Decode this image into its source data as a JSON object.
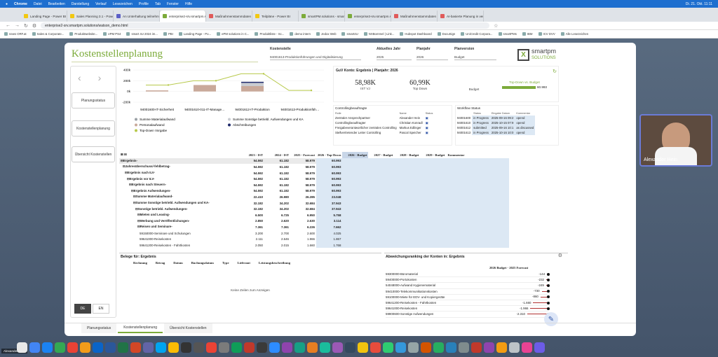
{
  "macbar": {
    "items": [
      "Chrome",
      "Datei",
      "Bearbeiten",
      "Darstellung",
      "Verlauf",
      "Lesezeichen",
      "Profile",
      "Tab",
      "Fenster",
      "Hilfe"
    ],
    "clock": "Di. 21. Okt. 11:11"
  },
  "tabs": [
    {
      "label": "Landing Page - Power BI",
      "color": "#f2c811"
    },
    {
      "label": "Sales Planning 3.1 - Power BI",
      "color": "#f2c811"
    },
    {
      "label": "An Unterhaltung teilnehmen",
      "color": "#5b5fc7"
    },
    {
      "label": "enterprise2-srv.smartpm.so",
      "color": "#7cab3a",
      "active": true
    },
    {
      "label": "Maßnahmenstammdaten P/",
      "color": "#e05a5a"
    },
    {
      "label": "Teilpläne - Power BI",
      "color": "#f2c811"
    },
    {
      "label": "smartPM.solutions - smart C",
      "color": "#7cab3a"
    },
    {
      "label": "enterprise3-srv.smartpm.so",
      "color": "#7cab3a"
    },
    {
      "label": "Maßnahmenstammdaten P/",
      "color": "#e05a5a"
    },
    {
      "label": "AI-basierte Planung in verti",
      "color": "#e05a5a"
    }
  ],
  "address": {
    "url": "enterprise2-srv.smartpm.solutions/watson_demo.html"
  },
  "bookmarks": [
    "news ORF.at",
    "Sales & Corporate...",
    "Produktwebsite...",
    "ePM PS4",
    "smart 4U 2024 im...",
    "PBI",
    "Landing Page - Po...",
    "ePM solutions in C...",
    "Produktliste - Sc...",
    "demo intern",
    "Jedox Web",
    "smart4U",
    "NXBommel | Link...",
    "Hubspot Dashboard",
    "DocuSign",
    "UniCredit Corpora...",
    "smartPMs",
    "IBM",
    "ICV DVV",
    "Alle Lesezeichen"
  ],
  "page": {
    "title": "Kostenstellenplanung",
    "filters": [
      {
        "label": "Kostenstelle",
        "value": "94001613-Produktionführungen und Digitalisierung"
      },
      {
        "label": "Aktuelles Jahr",
        "value": "2025"
      },
      {
        "label": "Planjahr",
        "value": "2026"
      },
      {
        "label": "Planversion",
        "value": "Budget"
      }
    ],
    "logo": {
      "top": "smartpm",
      "bottom": "SOLUTIONS"
    },
    "nav": [
      "Planungsstatus",
      "Kostenstellenplanung",
      "Übersicht Kostenstellen"
    ],
    "lang": [
      "DE",
      "EN"
    ]
  },
  "chart_data": {
    "type": "bar",
    "title": "",
    "categories": [
      "94001600-IT-Sicherheit",
      "94001610-011-IT-Management",
      "94001612-IT-Produktion",
      "94001613-Produktionführungen und Digitalisierung"
    ],
    "ylim": [
      -200,
      400
    ],
    "yticks": [
      "400k",
      "200k",
      "0k",
      "-200k"
    ],
    "series": [
      {
        "name": "Summe Materialaufwand",
        "color": "#9aa0a6",
        "values": [
          0,
          0,
          0,
          0
        ]
      },
      {
        "name": "Personalaufwand",
        "color": "#c9a99a",
        "values": [
          20000,
          120000,
          100000,
          0
        ]
      },
      {
        "name": "Summe Sonstige betriebl. Aufwendungen und KA",
        "color": "#c9ccd1",
        "values": [
          0,
          0,
          60000,
          0
        ]
      },
      {
        "name": "Abschreibungen",
        "color": "#1f2a6b",
        "values": [
          0,
          0,
          20000,
          0
        ]
      },
      {
        "name": "Top-Down Vorgabe",
        "color": "#b7c94a",
        "values": [
          120000,
          200000,
          330000,
          20000
        ]
      }
    ],
    "legend": [
      "Summe Materialaufwand",
      "Summe Sonstige betriebl. Aufwendungen und KA",
      "Personalaufwand",
      "Abschreibungen",
      "Top-Down Vorgabe"
    ]
  },
  "kpi": {
    "heading": "GuV Konto: Ergebnis | Planjahr: 2026",
    "cards": [
      {
        "value": "58,98K",
        "label": "IST VJ"
      },
      {
        "value": "60,99K",
        "label": "Top Down"
      },
      {
        "value": "",
        "label": "Budget"
      }
    ],
    "gauge": {
      "label": "Top-Down vs. Budget",
      "value": "60.993",
      "fill": 1.0
    }
  },
  "controlling": {
    "title": "Controllingbeauftragte",
    "headers": [
      "Rolle",
      "Name",
      "Status"
    ],
    "rows": [
      [
        "Zentraler Ansprechpartner",
        "Alexander Hein"
      ],
      [
        "Controllingbeauftragter",
        "Christian Konradl"
      ],
      [
        "Freigabeverantwortlicher zentrales Controlling",
        "Markus Edlinger"
      ],
      [
        "Stellvertretender Leiter Controlling",
        "Pascal Speicher"
      ]
    ]
  },
  "workflow": {
    "title": "Workflow Status",
    "headers": [
      "",
      "Status",
      "Eingabe Datum",
      "Kommentar"
    ],
    "rows": [
      [
        "94001600",
        "in Progress",
        "2025-09-16 09:2",
        "opend"
      ],
      [
        "94001610",
        "in Progress",
        "2025-10-15 07:9",
        "opend"
      ],
      [
        "94001612",
        "submitted",
        "2025-09-16 10:1",
        "as discussed"
      ],
      [
        "94001613",
        "in Progress",
        "2025-10-16 10:0",
        "opend"
      ]
    ]
  },
  "main": {
    "headers": [
      "2023 - IST",
      "2024 - IST",
      "2025 - Forecast",
      "2026 - Top-Down",
      "2026 - Budget",
      "2027 - Budget",
      "2028 - Budget",
      "2029 - Budget",
      "Kommentar"
    ],
    "rows": [
      {
        "label": "Ergebnis-",
        "lvl": 0,
        "v": [
          "54.592",
          "61.182",
          "58.979",
          "60.993"
        ]
      },
      {
        "label": "Jahresüberschuss/-fehlbetrag-",
        "lvl": 1,
        "v": [
          "54.592",
          "61.182",
          "58.979",
          "60.993"
        ]
      },
      {
        "label": "Ergebnis nach ILV-",
        "lvl": 2,
        "v": [
          "54.592",
          "61.182",
          "58.979",
          "60.993"
        ]
      },
      {
        "label": "Ergebnis vor ILV-",
        "lvl": 3,
        "v": [
          "54.592",
          "61.182",
          "58.979",
          "60.993"
        ]
      },
      {
        "label": "Ergebnis nach Steuern-",
        "lvl": 4,
        "v": [
          "54.592",
          "61.182",
          "58.979",
          "60.993"
        ]
      },
      {
        "label": "Ergebnis Aufwendungen-",
        "lvl": 5,
        "v": [
          "54.592",
          "61.182",
          "58.979",
          "60.993"
        ]
      },
      {
        "label": "Summe Materialaufwand-",
        "lvl": 6,
        "v": [
          "22.410",
          "26.980",
          "26.285",
          "23.048"
        ]
      },
      {
        "label": "Summe Sonstige betriebl. Aufwendungen und KA-",
        "lvl": 6,
        "v": [
          "32.182",
          "34.202",
          "32.684",
          "37.943"
        ]
      },
      {
        "label": "Sonstige betriebl. Aufwendungen-",
        "lvl": 7,
        "v": [
          "32.182",
          "34.202",
          "32.684",
          "37.943"
        ]
      },
      {
        "label": "Mieten und Leasing-",
        "lvl": 8,
        "v": [
          "6.500",
          "6.725",
          "6.950",
          "5.758"
        ]
      },
      {
        "label": "Werbung und Veröffentlichungen-",
        "lvl": 8,
        "v": [
          "2.850",
          "2.620",
          "2.630",
          "3.114"
        ]
      },
      {
        "label": "Reisen und Seminare-",
        "lvl": 8,
        "v": [
          "7.361",
          "7.361",
          "6.226",
          "7.662"
        ]
      },
      {
        "label": "59150000-Seminare und Schulungen",
        "lvl": 9,
        "v": [
          "3.200",
          "2.700",
          "2.600",
          "4.025"
        ]
      },
      {
        "label": "59641000-Reisekosten",
        "lvl": 9,
        "v": [
          "2.111",
          "2.646",
          "1.966",
          "1.867"
        ]
      },
      {
        "label": "59641200-Reisekosten - Fahrtkosten",
        "lvl": 9,
        "v": [
          "2.050",
          "2.015",
          "1.660",
          "1.768"
        ]
      }
    ]
  },
  "belege": {
    "title": "Belege für: Ergebnis",
    "headers": [
      "Rechnung",
      "Betrag",
      "Datum",
      "Buchungsdatum",
      "Type",
      "Lieferant",
      "Leistungsbeschreibung"
    ],
    "empty": "Keine Zeilen zum Anzeigen"
  },
  "abweichung": {
    "title": "Abweichungsranking der Konten in: Ergebnis",
    "header": "2026 Budget - 2025 Forecast",
    "rows": [
      {
        "label": "59300000-Büromaterial",
        "value": "-144"
      },
      {
        "label": "59400000-Portokosten",
        "value": "-232"
      },
      {
        "label": "54048000-Aufwand Hygienematerial",
        "value": "-249"
      },
      {
        "label": "59410000-Telekommunikationskosten",
        "value": "-730"
      },
      {
        "label": "59100000-Miete für EDV- und Kopiergeräte",
        "value": "-860"
      },
      {
        "label": "59641200-Reisekosten - Fahrtkosten",
        "value": "-1.660"
      },
      {
        "label": "59641000-Reisekosten",
        "value": "-1.966"
      },
      {
        "label": "59900600-Sonstige Aufwendungen",
        "value": "-2.310"
      }
    ]
  },
  "bottomtabs": [
    "Planungsstatus",
    "Kostenstellenplanung",
    "Übersicht Kostenstellen"
  ],
  "video": {
    "name": "Alexander Hein"
  },
  "dock_label": "Alexander Hein"
}
